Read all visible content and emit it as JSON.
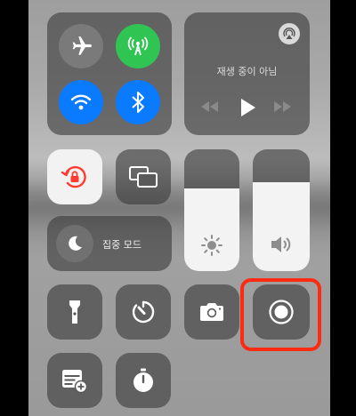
{
  "colors": {
    "connectivity_active_green": "#30c453",
    "connectivity_active_blue": "#0a7aff",
    "airplane_inactive": "#7a7a7a",
    "highlight_red": "#ff2a12",
    "rotation_lock_red": "#ff3b30"
  },
  "connectivity": {
    "airplane_icon": "airplane-icon",
    "cellular_icon": "cellular-antenna-icon",
    "wifi_icon": "wifi-icon",
    "bluetooth_icon": "bluetooth-icon"
  },
  "music": {
    "status": "재생 중이 아님",
    "airplay_icon": "airplay-icon"
  },
  "focus": {
    "label": "집중 모드",
    "icon": "moon-icon"
  },
  "sliders": {
    "brightness_level": 0.68,
    "volume_level": 0.73
  },
  "controls": {
    "rotation_lock_icon": "rotation-lock-icon",
    "screen_mirroring_icon": "screen-mirroring-icon",
    "flashlight_icon": "flashlight-icon",
    "timer_icon": "timer-icon",
    "camera_icon": "camera-icon",
    "screen_record_icon": "screen-record-icon",
    "notes_add_icon": "add-note-icon",
    "stopwatch_icon": "stopwatch-icon"
  }
}
